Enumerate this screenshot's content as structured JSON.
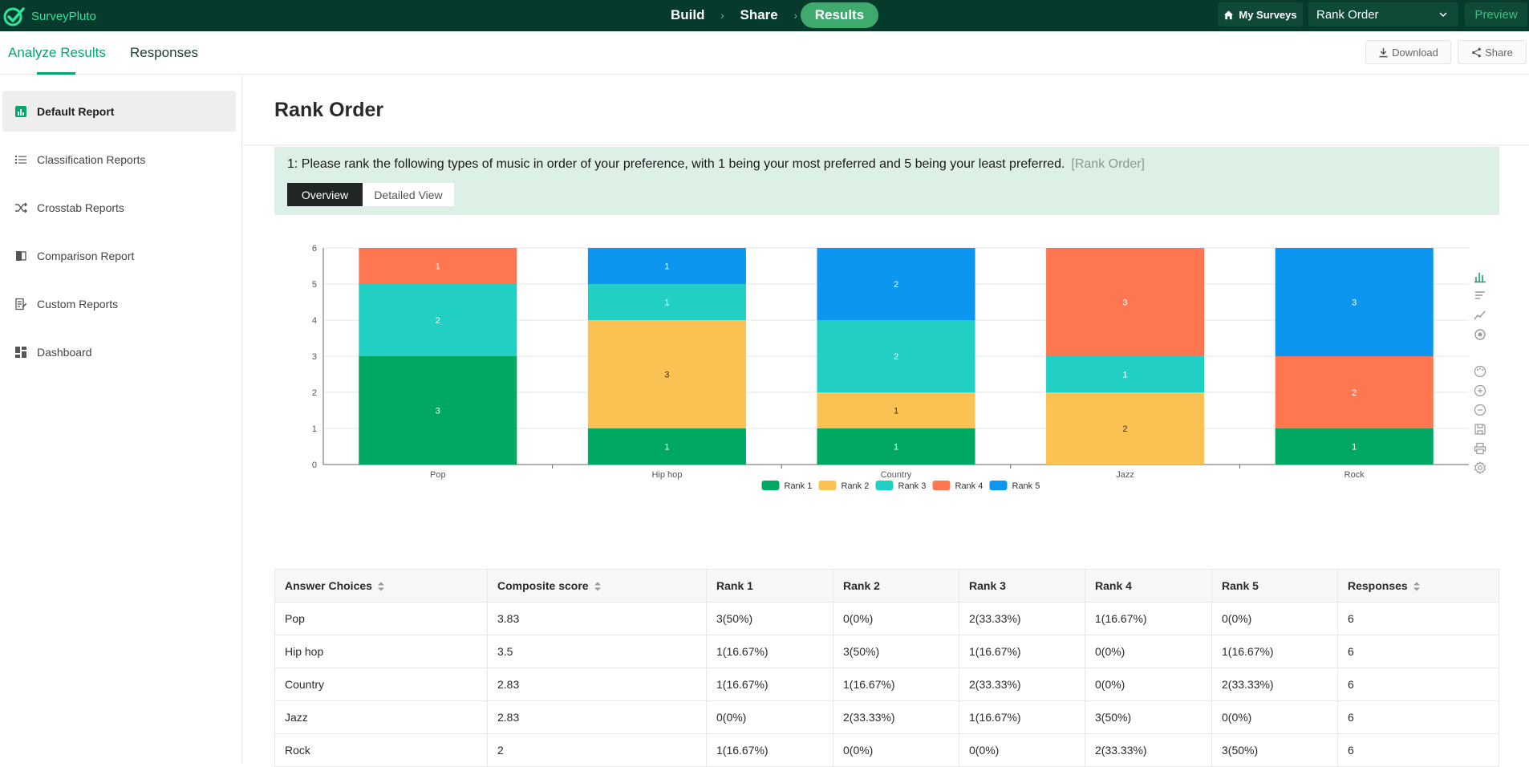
{
  "app": {
    "brand": "SurveyPluto"
  },
  "steps": [
    {
      "label": "Build"
    },
    {
      "label": "Share"
    },
    {
      "label": "Results"
    }
  ],
  "header": {
    "my_surveys": "My Surveys",
    "survey_selected": "Rank Order",
    "preview": "Preview"
  },
  "subtabs": {
    "analyze": "Analyze Results",
    "responses": "Responses"
  },
  "actions": {
    "download": "Download",
    "share": "Share"
  },
  "sidebar": {
    "items": [
      {
        "label": "Default Report",
        "icon": "bar-chart-icon"
      },
      {
        "label": "Classification Reports",
        "icon": "list-icon"
      },
      {
        "label": "Crosstab Reports",
        "icon": "shuffle-icon"
      },
      {
        "label": "Comparison Report",
        "icon": "compare-icon"
      },
      {
        "label": "Custom Reports",
        "icon": "document-edit-icon"
      },
      {
        "label": "Dashboard",
        "icon": "dashboard-icon"
      }
    ]
  },
  "page": {
    "title": "Rank Order"
  },
  "question": {
    "text": "1: Please rank the following types of music in order of your preference, with 1 being your most preferred and 5 being your least preferred.",
    "type": "[Rank Order]",
    "view_tabs": {
      "overview": "Overview",
      "detailed": "Detailed View"
    }
  },
  "colors": {
    "rank1": "#00a862",
    "rank2": "#fcc153",
    "rank3": "#21cfc5",
    "rank4": "#ff7750",
    "rank5": "#0c96f0",
    "brand_green": "#00a86b",
    "topbar": "#063a2c"
  },
  "chart_data": {
    "type": "bar",
    "stacked": true,
    "categories": [
      "Pop",
      "Hip hop",
      "Country",
      "Jazz",
      "Rock"
    ],
    "series": [
      {
        "name": "Rank 1",
        "values": [
          3,
          1,
          1,
          0,
          1
        ]
      },
      {
        "name": "Rank 2",
        "values": [
          0,
          3,
          1,
          2,
          0
        ]
      },
      {
        "name": "Rank 3",
        "values": [
          2,
          1,
          2,
          1,
          0
        ]
      },
      {
        "name": "Rank 4",
        "values": [
          1,
          0,
          0,
          3,
          2
        ]
      },
      {
        "name": "Rank 5",
        "values": [
          0,
          1,
          2,
          0,
          3
        ]
      }
    ],
    "ylim": [
      0,
      6
    ],
    "yticks": [
      0,
      1,
      2,
      3,
      4,
      5,
      6
    ],
    "grid": true,
    "legend": "bottom"
  },
  "table": {
    "headers": [
      "Answer Choices",
      "Composite score",
      "Rank 1",
      "Rank 2",
      "Rank 3",
      "Rank 4",
      "Rank 5",
      "Responses"
    ],
    "rows": [
      [
        "Pop",
        "3.83",
        "3(50%)",
        "0(0%)",
        "2(33.33%)",
        "1(16.67%)",
        "0(0%)",
        "6"
      ],
      [
        "Hip hop",
        "3.5",
        "1(16.67%)",
        "3(50%)",
        "1(16.67%)",
        "0(0%)",
        "1(16.67%)",
        "6"
      ],
      [
        "Country",
        "2.83",
        "1(16.67%)",
        "1(16.67%)",
        "2(33.33%)",
        "0(0%)",
        "2(33.33%)",
        "6"
      ],
      [
        "Jazz",
        "2.83",
        "0(0%)",
        "2(33.33%)",
        "1(16.67%)",
        "3(50%)",
        "0(0%)",
        "6"
      ],
      [
        "Rock",
        "2",
        "1(16.67%)",
        "0(0%)",
        "0(0%)",
        "2(33.33%)",
        "3(50%)",
        "6"
      ]
    ]
  }
}
